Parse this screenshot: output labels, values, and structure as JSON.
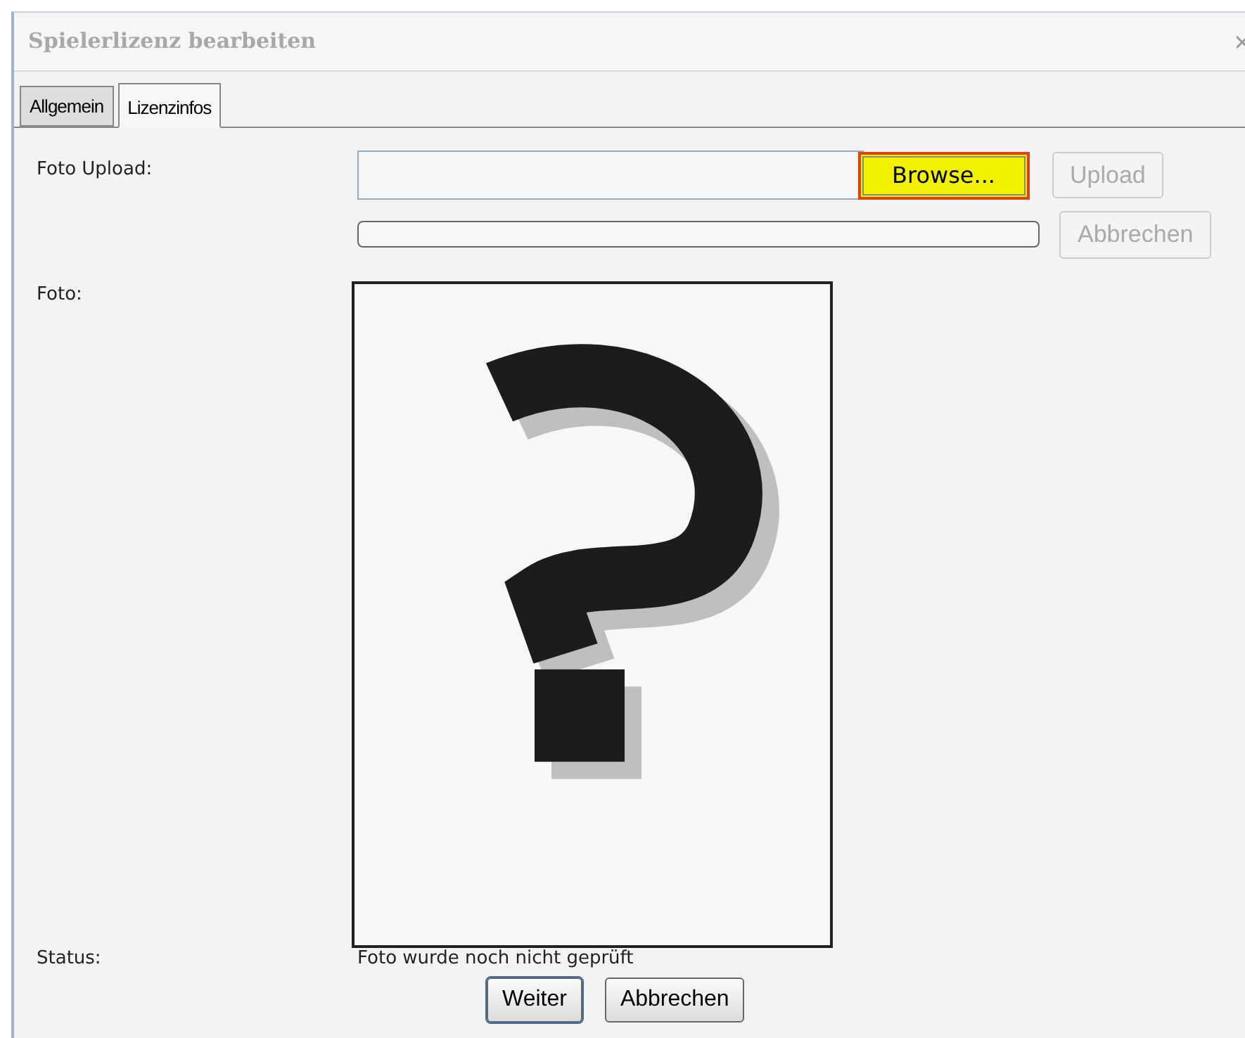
{
  "window": {
    "title": "Spielerlizenz bearbeiten"
  },
  "tabs": [
    {
      "label": "Allgemein",
      "selected": false
    },
    {
      "label": "Lizenzinfos",
      "selected": true
    }
  ],
  "upload": {
    "label": "Foto Upload:",
    "browse_button": {
      "label": "Browse...",
      "highlighted": true
    },
    "upload_button": {
      "label": "Upload",
      "disabled": true
    },
    "progress": {
      "level": 0
    },
    "cancel_button": {
      "label": "Abbrechen",
      "disabled": true
    }
  },
  "photo": {
    "label": "Foto:",
    "kind": "picture"
  },
  "status": {
    "label": "Status:",
    "value": "Foto wurde noch nicht geprüft"
  },
  "buttons": [
    {
      "label": "Weiter",
      "selected": true
    },
    {
      "label": "Abbrechen",
      "selected": false
    }
  ]
}
